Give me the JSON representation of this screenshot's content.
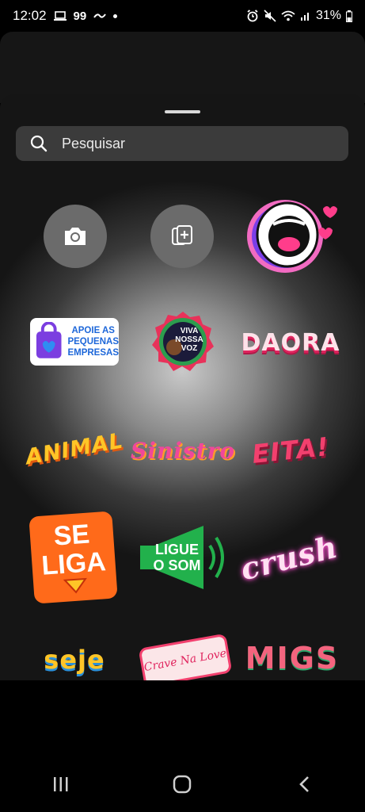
{
  "status_bar": {
    "time": "12:02",
    "notif_99": "99",
    "battery": "31%"
  },
  "search": {
    "placeholder": "Pesquisar"
  },
  "stickers": {
    "pequenas_line1": "APOIE AS",
    "pequenas_line2": "PEQUENAS",
    "pequenas_line3": "EMPRESAS",
    "viva_line1": "VIVA",
    "viva_line2": "NOSSA",
    "viva_line3": "VOZ",
    "daora": "DAORA",
    "animal": "ANIMAL",
    "sinistro": "Sinistro",
    "eita": "EITA!",
    "se": "SE",
    "liga": "LIGA",
    "ligue": "LIGUE",
    "o_som": "O SOM",
    "crush": "crush",
    "seje": "seje",
    "crave": "Crave Na Love",
    "migs": "MIGS"
  },
  "colors": {
    "sheet_center": "#c9c9c9",
    "search_bg": "#3b3b3b",
    "circle_btn": "#6b6b6b"
  }
}
